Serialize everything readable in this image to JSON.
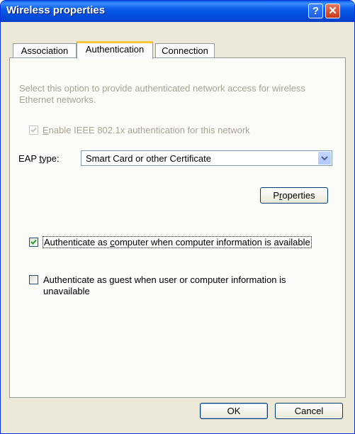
{
  "window": {
    "title": "Wireless properties"
  },
  "tabs": [
    {
      "label": "Association",
      "active": false
    },
    {
      "label": "Authentication",
      "active": true
    },
    {
      "label": "Connection",
      "active": false
    }
  ],
  "auth": {
    "description": "Select this option to provide authenticated network access for wireless Ethernet networks.",
    "enable_8021x": {
      "label_accel": "E",
      "label_rest": "nable IEEE 802.1x authentication for this network",
      "checked": true,
      "disabled": true
    },
    "eap_label_pre": "EAP ",
    "eap_label_accel": "t",
    "eap_label_post": "ype:",
    "eap_value": "Smart Card or other Certificate",
    "properties_pre": "P",
    "properties_accel": "r",
    "properties_post": "operties",
    "auth_computer": {
      "pre": "Authenticate as ",
      "accel": "c",
      "post": "omputer when computer information is available",
      "checked": true
    },
    "auth_guest": {
      "pre": "Authenticate as ",
      "accel": "g",
      "post": "uest when user or computer information is",
      "line2": "unavailable",
      "checked": false
    }
  },
  "buttons": {
    "ok": "OK",
    "cancel": "Cancel"
  },
  "icons": {
    "help": "help-icon",
    "close": "close-icon",
    "dropdown": "chevron-down-icon"
  },
  "colors": {
    "title_bar": "#0a5ae8",
    "dialog_bg": "#ece9d8",
    "check": "#21a121"
  }
}
